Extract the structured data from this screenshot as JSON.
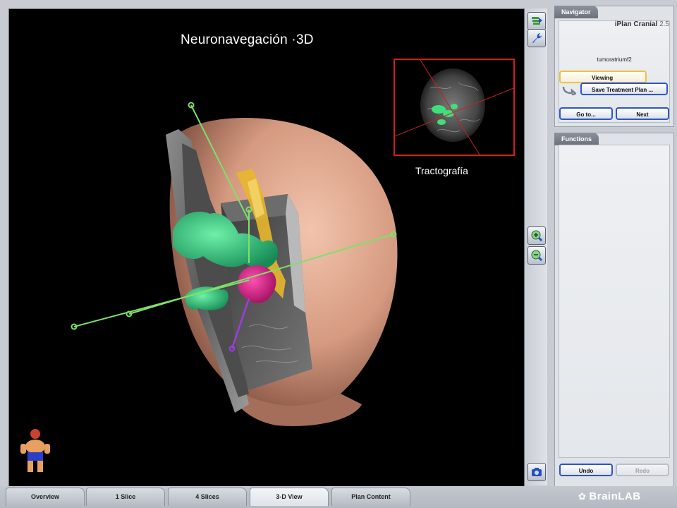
{
  "viewport": {
    "title": "Neuronavegación ·3D",
    "inset_caption": "Tractografía"
  },
  "tool_strip": {
    "top_icons": [
      "layers-icon",
      "wrench-icon"
    ],
    "zoom_icons": [
      "zoom-in-icon",
      "zoom-out-icon"
    ],
    "bottom_icon": "camera-icon"
  },
  "navigator": {
    "tab": "Navigator",
    "app_name": "iPlan Cranial",
    "version": "2.5",
    "patient": "tumoratriumf2",
    "viewing_label": "Viewing",
    "save_label": "Save Treatment Plan ...",
    "goto_label": "Go to...",
    "next_label": "Next"
  },
  "functions": {
    "tab": "Functions",
    "undo_label": "Undo",
    "redo_label": "Redo"
  },
  "tabs": [
    {
      "label": "Overview"
    },
    {
      "label": "1 Slice"
    },
    {
      "label": "4 Slices"
    },
    {
      "label": "3-D View",
      "active": true
    },
    {
      "label": "Plan Content"
    }
  ],
  "logo": {
    "text": "BrainLAB"
  },
  "colors": {
    "accent_blue": "#2e55c8",
    "viewing_yellow": "#f0c040",
    "inset_border": "#d21f1f",
    "skin": "#d9a48a",
    "tract_green": "#2fb877",
    "tumor_magenta": "#d0157e",
    "trajectory_green": "#7ee06a"
  }
}
